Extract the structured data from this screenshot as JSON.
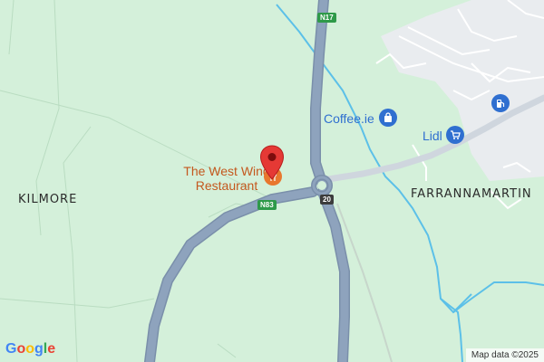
{
  "map": {
    "place_labels": {
      "kilmore": "KILMORE",
      "farrannamartin": "FARRANNAMARTIN"
    },
    "pois": {
      "restaurant": {
        "name_line1": "The West Wing",
        "name_line2": "Restaurant",
        "icon": "restaurant-icon",
        "color": "#c4581e"
      },
      "coffee": {
        "name": "Coffee.ie",
        "icon": "shopping-bag-icon",
        "color": "#2f6fd0"
      },
      "lidl": {
        "name": "Lidl",
        "icon": "shopping-cart-icon",
        "color": "#2f6fd0"
      },
      "fuel": {
        "icon": "fuel-pump-icon",
        "color": "#2f6fd0"
      }
    },
    "road_shields": {
      "n17": "N17",
      "n83": "N83",
      "r20": "20"
    },
    "marker": {
      "icon": "map-pin-icon",
      "color": "#e53935"
    },
    "attribution": "Map data ©2025",
    "logo": "Google",
    "colors": {
      "land": "#d4f0da",
      "road": "#8ea3bd",
      "road_edge": "#7a8faa",
      "minor_road": "#ffffff",
      "water": "#5cc0e8",
      "built_up": "#e9ecef"
    }
  }
}
